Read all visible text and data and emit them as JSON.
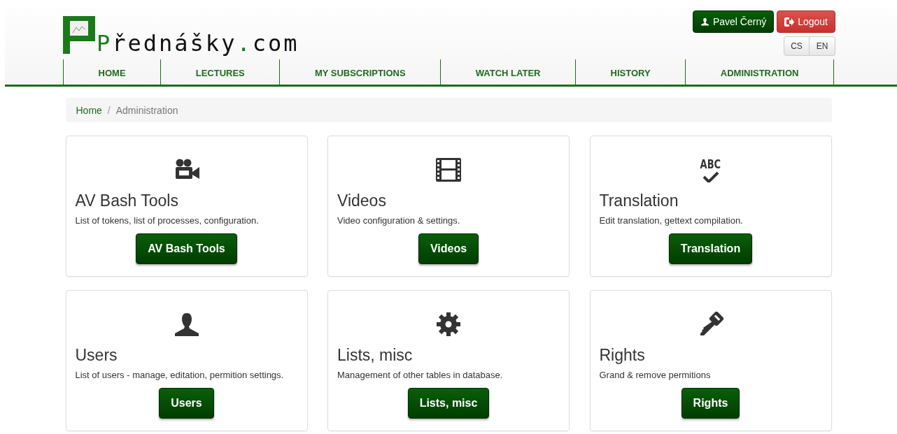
{
  "logo": {
    "initial": "P",
    "name": "řednášky",
    "dot": ".",
    "tld": "com"
  },
  "user_button": {
    "label": "Pavel Černý"
  },
  "logout_button": {
    "label": "Logout"
  },
  "languages": [
    "CS",
    "EN"
  ],
  "nav": [
    "HOME",
    "LECTURES",
    "MY SUBSCRIPTIONS",
    "WATCH LATER",
    "HISTORY",
    "ADMINISTRATION"
  ],
  "breadcrumb": [
    "Home",
    "Administration"
  ],
  "breadcrumb_separator": "/",
  "cards": [
    {
      "kind": "camera",
      "title": "AV Bash Tools",
      "description": "List of tokens, list of processes, configuration.",
      "button": "AV Bash Tools"
    },
    {
      "kind": "film",
      "title": "Videos",
      "description": "Video configuration & settings.",
      "button": "Videos"
    },
    {
      "kind": "spellcheck",
      "icon_text": "ABC",
      "title": "Translation",
      "description": "Edit translation, gettext compilation.",
      "button": "Translation"
    },
    {
      "kind": "user",
      "title": "Users",
      "description": "List of users - manage, editation, permition settings.",
      "button": "Users"
    },
    {
      "kind": "gear",
      "title": "Lists, misc",
      "description": "Management of other tables in database.",
      "button": "Lists, misc"
    },
    {
      "kind": "key",
      "title": "Rights",
      "description": "Grand & remove permitions",
      "button": "Rights"
    }
  ]
}
